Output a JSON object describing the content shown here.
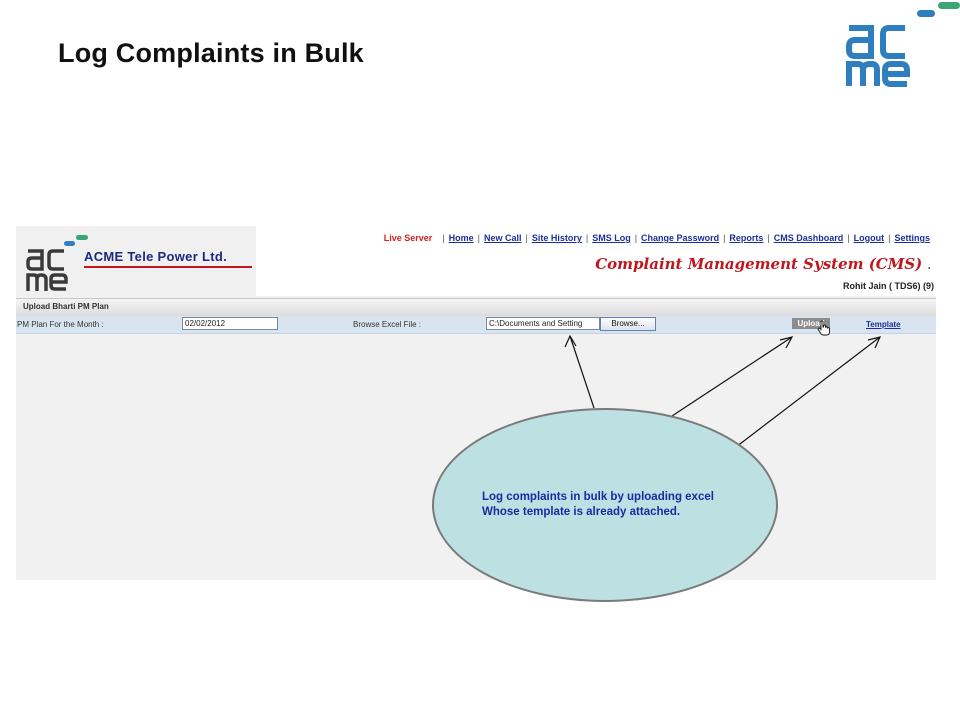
{
  "slide": {
    "title": "Log Complaints in Bulk",
    "logo_icon": "acme-logo-icon"
  },
  "app": {
    "company_name": "ACME Tele Power Ltd.",
    "logo_icon": "acme-logo-icon",
    "server_label": "Live Server",
    "nav": [
      "Home",
      "New Call",
      "Site History",
      "SMS Log",
      "Change Password",
      "Reports",
      "CMS Dashboard",
      "Logout",
      "Settings"
    ],
    "system_title": "Complaint Management System (CMS)",
    "system_title_suffix": ".",
    "user": "Rohit Jain ( TDS6) (9)",
    "page_title": "Upload Bharti PM Plan",
    "form": {
      "month_label": "PM Plan For the Month :",
      "month_value": "02/02/2012",
      "file_label": "Browse Excel File :",
      "file_value": "C:\\Documents and Setting",
      "browse_label": "Browse...",
      "upload_label": "Upload",
      "template_label": "Template"
    }
  },
  "callout": {
    "line1": "Log complaints in bulk by uploading excel",
    "line2": "Whose template is already attached."
  },
  "colors": {
    "brand_blue": "#2f7fc0",
    "brand_green": "#3aa676",
    "nav_link": "#1c2f9a",
    "live_server": "#d42020",
    "cms_title": "#c0171e",
    "callout_fill": "#bde0e3"
  }
}
